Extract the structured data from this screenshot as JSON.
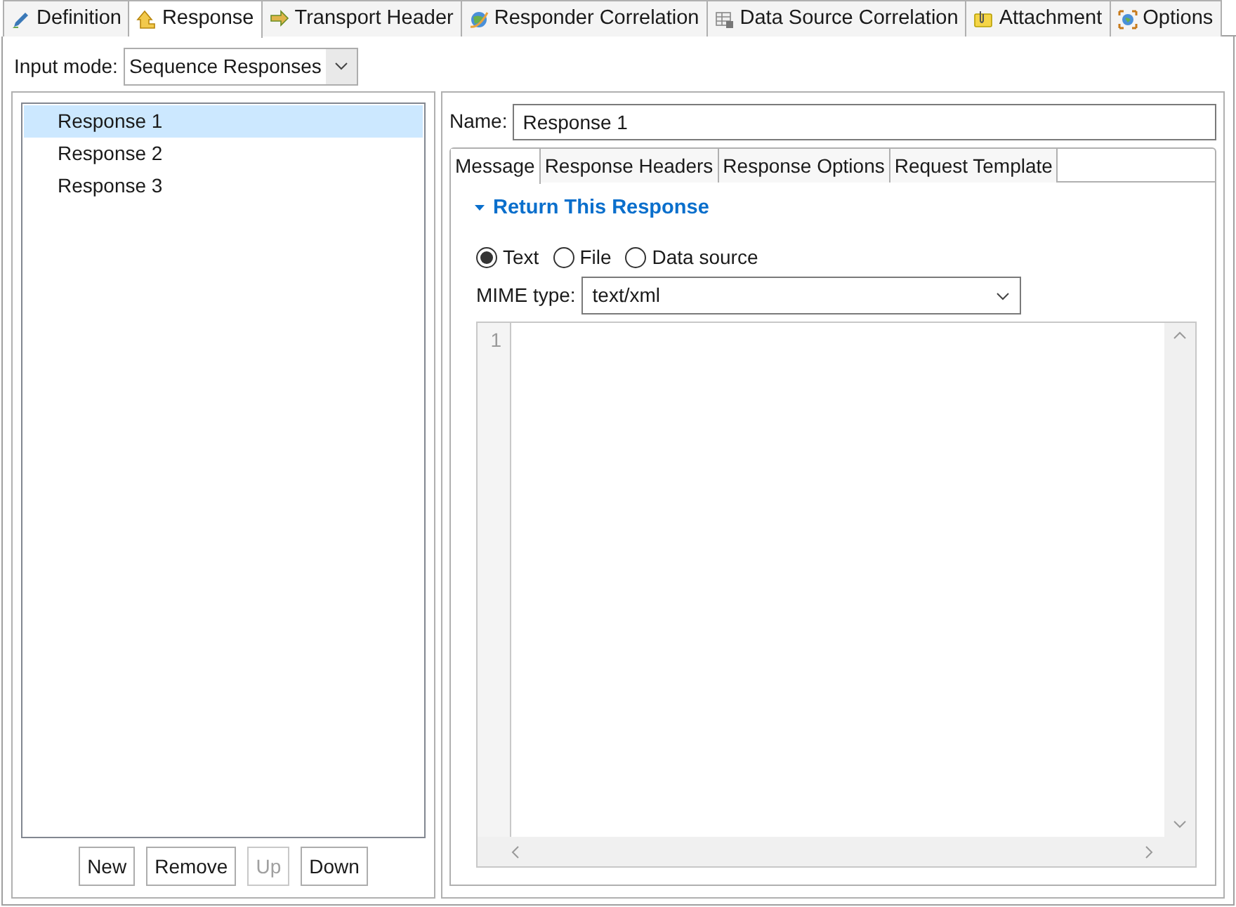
{
  "tabs": [
    {
      "label": "Definition",
      "selected": false
    },
    {
      "label": "Response",
      "selected": true
    },
    {
      "label": "Transport Header",
      "selected": false
    },
    {
      "label": "Responder Correlation",
      "selected": false
    },
    {
      "label": "Data Source Correlation",
      "selected": false
    },
    {
      "label": "Attachment",
      "selected": false
    },
    {
      "label": "Options",
      "selected": false
    }
  ],
  "input_mode": {
    "label": "Input mode:",
    "value": "Sequence Responses"
  },
  "responses": [
    {
      "label": "Response 1",
      "selected": true
    },
    {
      "label": "Response 2",
      "selected": false
    },
    {
      "label": "Response 3",
      "selected": false
    }
  ],
  "list_buttons": [
    {
      "label": "New",
      "disabled": false
    },
    {
      "label": "Remove",
      "disabled": false
    },
    {
      "label": "Up",
      "disabled": true
    },
    {
      "label": "Down",
      "disabled": false
    }
  ],
  "name_field": {
    "label": "Name:",
    "value": "Response 1"
  },
  "detail_tabs": [
    {
      "label": "Message",
      "selected": true
    },
    {
      "label": "Response Headers",
      "selected": false
    },
    {
      "label": "Response Options",
      "selected": false
    },
    {
      "label": "Request Template",
      "selected": false
    }
  ],
  "section": {
    "title": "Return This Response",
    "expanded": true
  },
  "source_options": [
    {
      "label": "Text",
      "selected": true
    },
    {
      "label": "File",
      "selected": false
    },
    {
      "label": "Data source",
      "selected": false
    }
  ],
  "mime_type": {
    "label": "MIME type:",
    "value": "text/xml"
  },
  "editor": {
    "line_numbers": [
      "1"
    ]
  }
}
